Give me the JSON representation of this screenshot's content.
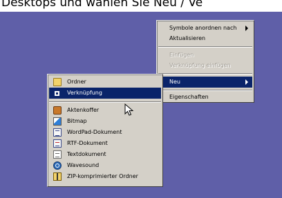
{
  "caption": "Desktops und wählen Sie Neu / Ve",
  "context_menu": {
    "items": [
      {
        "label": "Symbole anordnen nach",
        "has_submenu": true
      },
      {
        "label": "Aktualisieren"
      },
      {
        "label": "Einfügen",
        "disabled": true
      },
      {
        "label": "Verknüpfung einfügen",
        "disabled": true
      },
      {
        "label": "Neu",
        "has_submenu": true,
        "highlighted": true
      },
      {
        "label": "Eigenschaften"
      }
    ]
  },
  "new_submenu": {
    "folder": {
      "label": "Ordner",
      "icon": "folder-icon"
    },
    "shortcut": {
      "label": "Verknüpfung",
      "icon": "shortcut-icon",
      "highlighted": true
    },
    "documents": [
      {
        "label": "Aktenkoffer",
        "icon": "briefcase-icon"
      },
      {
        "label": "Bitmap",
        "icon": "bitmap-icon"
      },
      {
        "label": "WordPad-Dokument",
        "icon": "wordpad-icon"
      },
      {
        "label": "RTF-Dokument",
        "icon": "rtf-document-icon"
      },
      {
        "label": "Textdokument",
        "icon": "text-document-icon"
      },
      {
        "label": "Wavesound",
        "icon": "wavesound-icon"
      },
      {
        "label": "ZIP-komprimierter Ordner",
        "icon": "zip-folder-icon"
      }
    ]
  },
  "colors": {
    "desktop": "#5f5fa8",
    "menu_bg": "#d4d0c8",
    "highlight": "#0a246a",
    "disabled_text": "#a39f97"
  }
}
